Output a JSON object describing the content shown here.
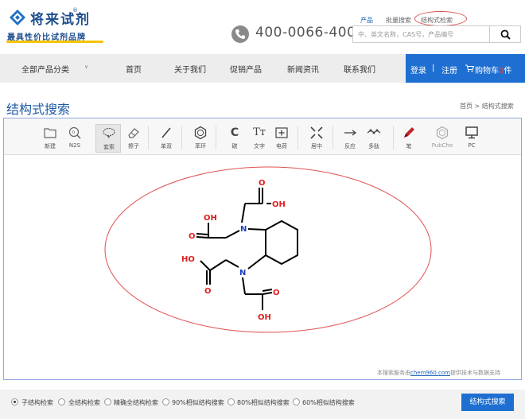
{
  "header": {
    "brand_name": "将来试剂",
    "brand_reg": "®",
    "slogan": "最具性价比试剂品牌",
    "phone": "400-0066-400",
    "top_links": [
      "产品",
      "批量搜索",
      "结构式检索"
    ],
    "search_placeholder": "中、英文名称，CAS号，产品编号"
  },
  "nav": {
    "items": [
      "全部产品分类",
      "首页",
      "关于我们",
      "促销产品",
      "新闻资讯",
      "联系我们"
    ],
    "caret": "∨",
    "login": "登录",
    "divider": "|",
    "register": "注册",
    "cart_label": "购物车",
    "cart_count": "0",
    "cart_unit": "件"
  },
  "page": {
    "title": "结构式搜索",
    "breadcrumb": "首页 > 结构式搜索"
  },
  "toolbar": {
    "tools": [
      "新建",
      "N2S",
      "套索",
      "擦子",
      "单双",
      "苯环",
      "碳",
      "文字",
      "电荷",
      "居中",
      "反应",
      "多肽",
      "笔",
      "PubChe",
      "PC"
    ],
    "letters": {
      "c": "C",
      "t": "Tт"
    }
  },
  "molecule": {
    "atoms": {
      "oh": "OH",
      "ho": "HO",
      "o": "O",
      "n": "N"
    }
  },
  "credit": {
    "prefix": "本搜索服务由",
    "link": "chem960.com",
    "suffix": "提供技术与数据支持"
  },
  "options": {
    "items": [
      "子结构检索",
      "全结构检索",
      "精确全结构检索",
      "90%相似结构搜索",
      "80%相似结构搜索",
      "60%相似结构搜索"
    ],
    "selected_index": 0,
    "submit": "结构式搜索"
  },
  "colors": {
    "accent": "#1e6fd1",
    "title": "#1e5aa6",
    "annotation": "#d9534f",
    "nitrogen": "#1e3fbf",
    "oxygen": "#e02020"
  }
}
